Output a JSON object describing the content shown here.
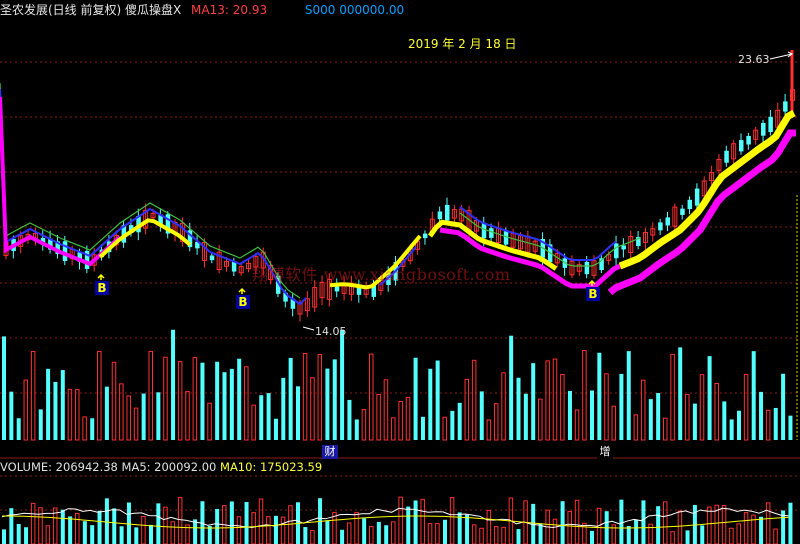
{
  "header": {
    "title": "圣农发展(日线 前复权) 傻瓜操盘X",
    "ma13_label": "MA13: 20.93",
    "stock_info": "S000 000000.00"
  },
  "date_label": "2019 年 2 月 18 日",
  "watermark": "翔博软件 www.xiangbosoft.com",
  "high_label": "23.63",
  "low_label": "14.05",
  "buy_marker": "B",
  "event_tags": [
    "财",
    "增"
  ],
  "volume_header": {
    "volume": "VOLUME: 206942.38",
    "ma5": "MA5: 200092.00",
    "ma10": "MA10: 175023.59"
  },
  "colors": {
    "up": "#ff3030",
    "down": "#54ffff",
    "ma_yellow": "#ffff00",
    "ma_magenta": "#ff00ff",
    "ma_green": "#40c040",
    "ma_blue": "#3030ff",
    "grid": "#8b1a1a"
  },
  "chart_data": {
    "type": "candlestick",
    "price_range": [
      13.5,
      24.3
    ],
    "high_point": 23.63,
    "low_point": 14.05,
    "buy_signal_count": 3,
    "volume_bars": 108
  }
}
